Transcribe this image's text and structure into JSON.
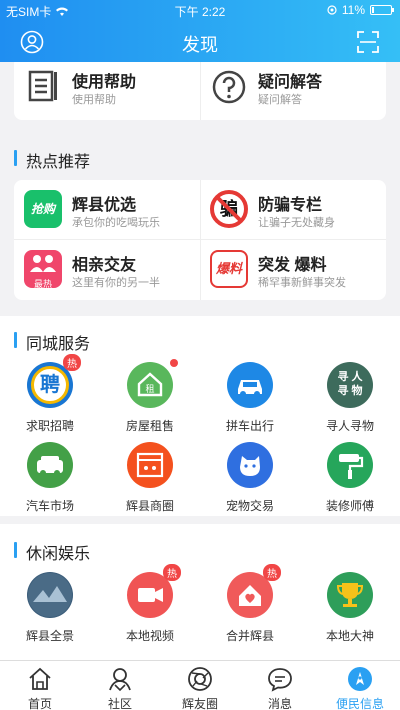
{
  "status_bar": {
    "carrier": "无SIM卡",
    "time": "下午 2:22",
    "battery": "11%",
    "battery_level": 0.11
  },
  "header": {
    "title": "发现"
  },
  "help": [
    {
      "title": "使用帮助",
      "subtitle": "使用帮助",
      "icon": "document-icon"
    },
    {
      "title": "疑问解答",
      "subtitle": "疑问解答",
      "icon": "question-icon"
    }
  ],
  "hot": {
    "title": "热点推荐",
    "items": [
      {
        "title": "辉县优选",
        "subtitle": "承包你的吃喝玩乐",
        "icon_text": "抢购",
        "color": "#19c06b"
      },
      {
        "title": "防骗专栏",
        "subtitle": "让骗子无处藏身",
        "icon_text": "骗",
        "color": "#e53935"
      },
      {
        "title": "相亲交友",
        "subtitle": "这里有你的另一半",
        "icon_text": "最热",
        "color": "#f0466b"
      },
      {
        "title": "突发 爆料",
        "subtitle": "稀罕事新鲜事突发",
        "icon_text": "爆料",
        "color": "#e53935"
      }
    ]
  },
  "city": {
    "title": "同城服务",
    "items": [
      {
        "label": "求职招聘",
        "icon_text": "聘",
        "color": "#1976d2",
        "badge": "热"
      },
      {
        "label": "房屋租售",
        "icon_text": "租",
        "color": "#59b75c",
        "dot": true
      },
      {
        "label": "拼车出行",
        "icon_text": "car",
        "color": "#1e88e5"
      },
      {
        "label": "寻人寻物",
        "icon_text": "寻人寻物",
        "color": "#3d6b5c"
      },
      {
        "label": "汽车市场",
        "icon_text": "car2",
        "color": "#43a047"
      },
      {
        "label": "辉县商圈",
        "icon_text": "shop",
        "color": "#f4511e"
      },
      {
        "label": "宠物交易",
        "icon_text": "pet",
        "color": "#2f6fe0"
      },
      {
        "label": "装修师傅",
        "icon_text": "roller",
        "color": "#26a65b"
      }
    ]
  },
  "leisure": {
    "title": "休闲娱乐",
    "items": [
      {
        "label": "辉县全景",
        "color": "#3b5d7a"
      },
      {
        "label": "本地视频",
        "color": "#f05454",
        "badge": "热"
      },
      {
        "label": "合并辉县",
        "color": "#f05a5a",
        "badge": "热"
      },
      {
        "label": "本地大神",
        "color": "#2e9e5a"
      }
    ]
  },
  "tabs": [
    {
      "label": "首页",
      "icon": "home-icon"
    },
    {
      "label": "社区",
      "icon": "community-icon"
    },
    {
      "label": "辉友圈",
      "icon": "camera-icon"
    },
    {
      "label": "消息",
      "icon": "message-icon"
    },
    {
      "label": "便民信息",
      "icon": "rocket-icon",
      "active": true
    }
  ]
}
